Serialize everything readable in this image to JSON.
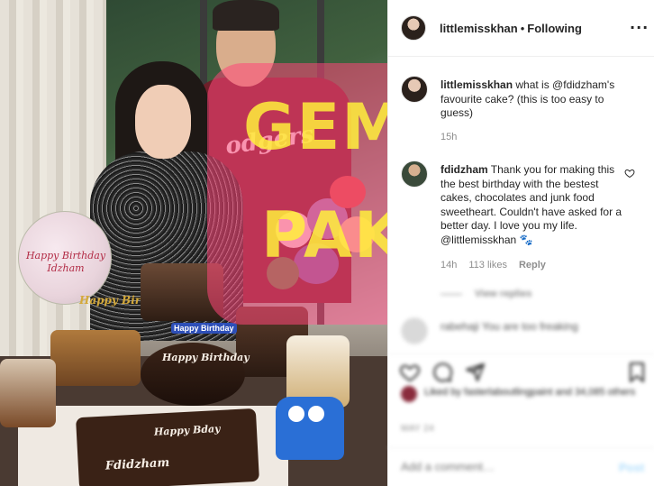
{
  "post": {
    "username": "littlemisskhan",
    "separator": "•",
    "follow_state": "Following",
    "more_icon": "more-horizontal-icon"
  },
  "photo": {
    "balloon_text": "Happy Birthday Idzham",
    "sign_text": "Happy Birthday",
    "topper_text": "Happy Birthday",
    "cake_text_left": "Fdidzham",
    "cake_text_bday": "Happy Bday",
    "watermark_line1": "GEM",
    "watermark_line2": "PAKS"
  },
  "comments": [
    {
      "username": "littlemisskhan",
      "text_before": " what is ",
      "mention": "@fdidzham",
      "text_after": "'s favourite cake? (this is too easy to guess)",
      "time": "15h"
    },
    {
      "username": "fdidzham",
      "text_before": " Thank you for making this the best birthday with the bestest cakes, chocolates and junk food sweetheart. Couldn't have asked for a better day. I love you my life. ",
      "mention": "@littlemisskhan",
      "text_after": " 🐾",
      "time": "14h",
      "likes": "113 likes",
      "reply_label": "Reply"
    }
  ],
  "view_replies": "View replies",
  "blurred_comment": "rabehaji You are too freaking",
  "likes_text": "Liked by fasterlaboutlingpaint and 34,085 others",
  "date_text": "May 24",
  "add_comment_placeholder": "Add a comment…",
  "post_button": "Post"
}
